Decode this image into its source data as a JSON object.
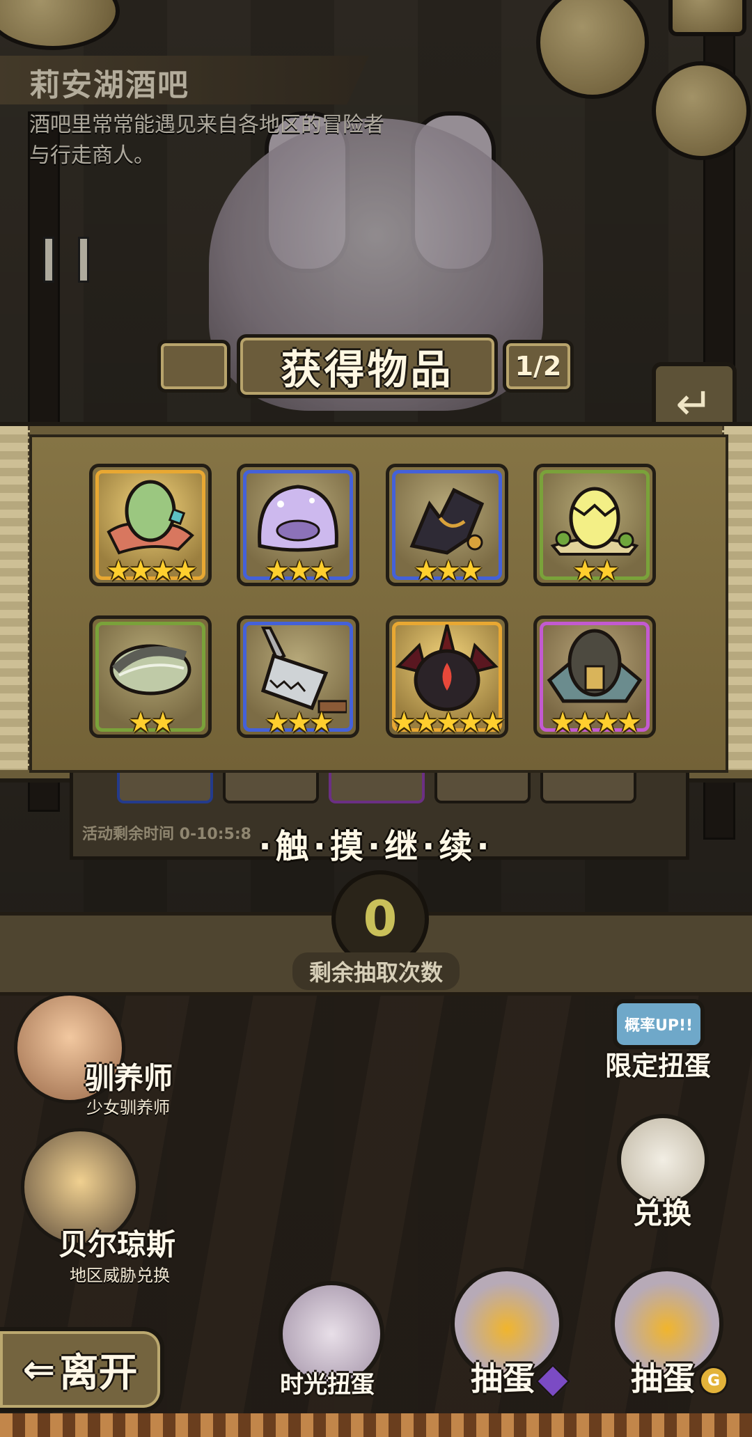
{
  "location": {
    "title": "莉安湖酒吧",
    "description": "酒吧里常常能遇见来自各地区的冒险者与行走商人。"
  },
  "reward_panel": {
    "title": "获得物品",
    "page": "1/2",
    "items": [
      {
        "icon": "green-egg-icon",
        "rarity": "gold",
        "stars": 4
      },
      {
        "icon": "jelly-slime-icon",
        "rarity": "blue",
        "stars": 3
      },
      {
        "icon": "bat-wing-icon",
        "rarity": "blue",
        "stars": 3
      },
      {
        "icon": "hatching-egg-icon",
        "rarity": "green",
        "stars": 2
      },
      {
        "icon": "leaf-egg-icon",
        "rarity": "green",
        "stars": 2
      },
      {
        "icon": "cleaver-icon",
        "rarity": "blue",
        "stars": 3
      },
      {
        "icon": "demon-helmet-icon",
        "rarity": "gold",
        "stars": 5
      },
      {
        "icon": "armored-egg-icon",
        "rarity": "purple",
        "stars": 4
      }
    ],
    "continue_text": "·触·摸·继·续·",
    "timer_label": "活动剩余时间 0-10:5:8"
  },
  "draw": {
    "remaining": "0",
    "remaining_label": "剩余抽取次数"
  },
  "npcs": [
    {
      "name": "驯养师",
      "subtitle": "少女驯养师"
    },
    {
      "name": "贝尔琼斯",
      "subtitle": "地区威胁兑换"
    }
  ],
  "buttons": {
    "limited_gacha": "限定扭蛋",
    "limited_badge": "概率UP!!",
    "exchange": "兑换",
    "time_gacha": "时光扭蛋",
    "draw_gem": "抽蛋",
    "draw_gold": "抽蛋",
    "leave": "离开"
  },
  "colors": {
    "gold_frame": "#e9a832",
    "blue_frame": "#4461d9",
    "green_frame": "#7aa23a",
    "purple_frame": "#c35ad0",
    "star": "#ffcf2e"
  }
}
